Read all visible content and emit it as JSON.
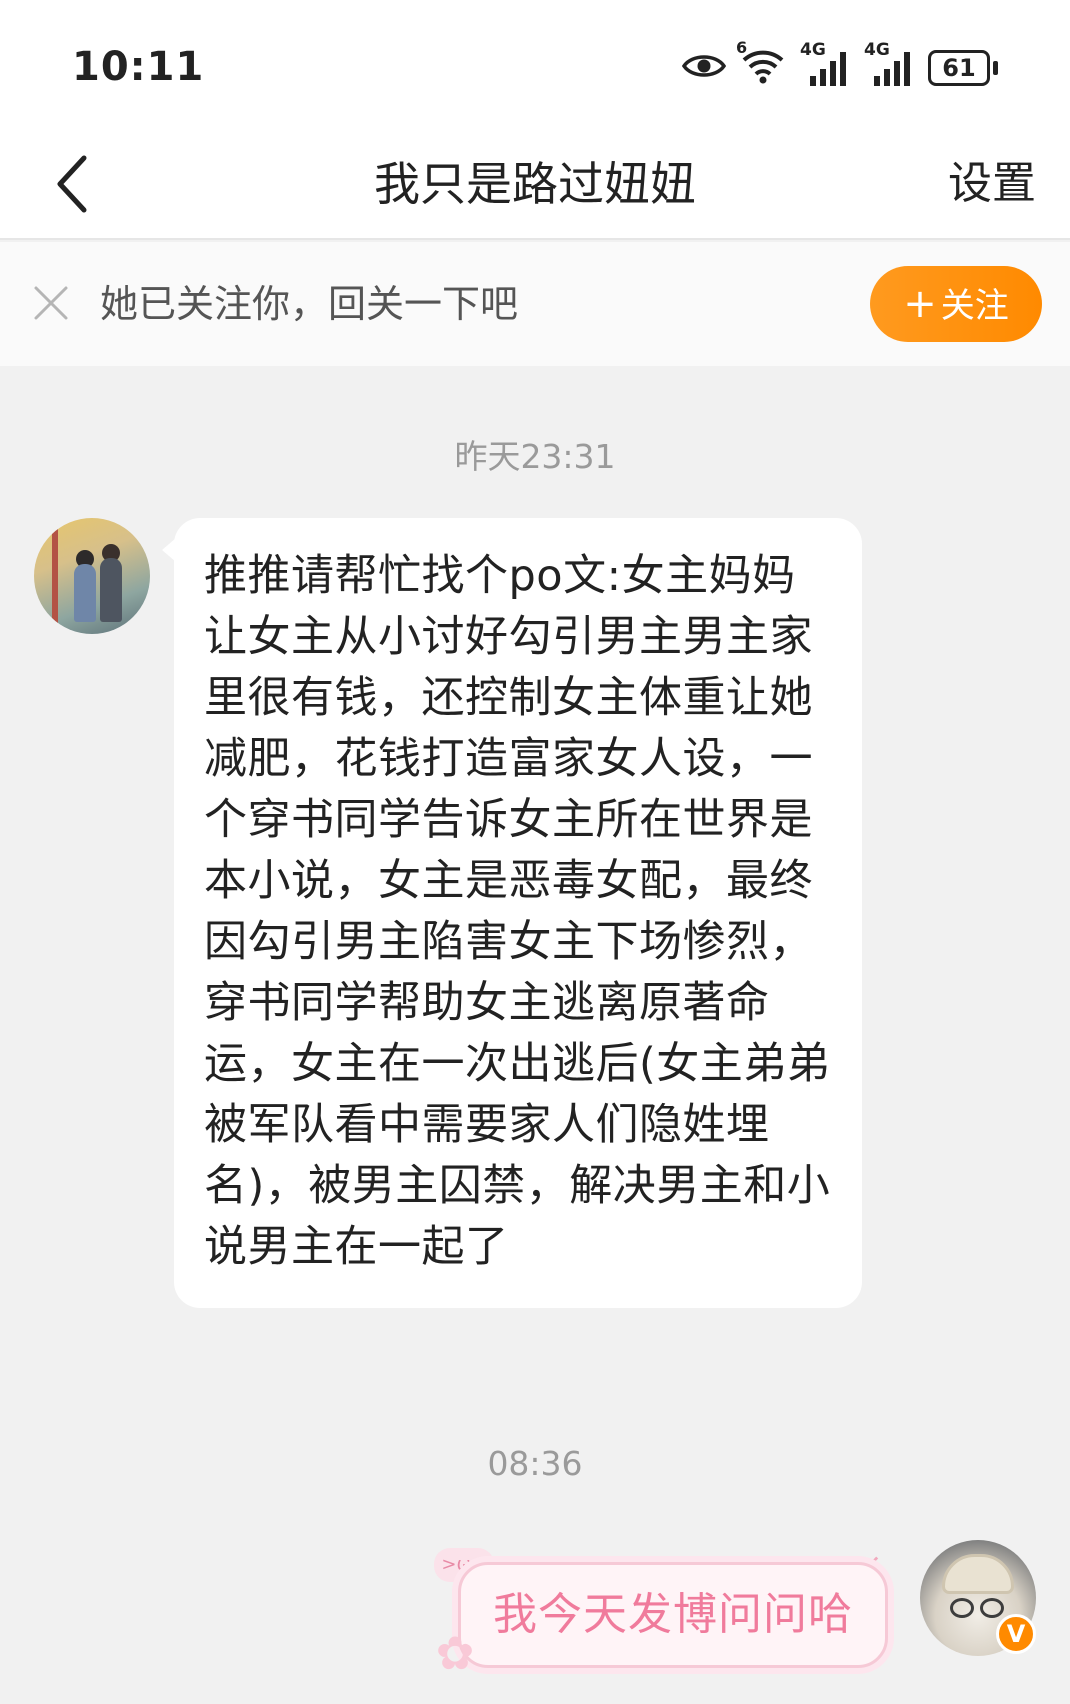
{
  "status_bar": {
    "time": "10:11",
    "wifi_superscript": "6",
    "signal1_label": "4G",
    "signal2_label": "4G",
    "battery": "61"
  },
  "nav": {
    "title": "我只是路过妞妞",
    "settings_label": "设置"
  },
  "follow_banner": {
    "text": "她已关注你，回关一下吧",
    "button_label": "关注",
    "button_color": "#ff9a1f"
  },
  "messages": [
    {
      "timestamp": "昨天23:31",
      "sender": "other",
      "text": "推推请帮忙找个po文:女主妈妈让女主从小讨好勾引男主男主家里很有钱，还控制女主体重让她减肥，花钱打造富家女人设，一个穿书同学告诉女主所在世界是本小说，女主是恶毒女配，最终因勾引男主陷害女主下场惨烈，穿书同学帮助女主逃离原著命运，女主在一次出逃后(女主弟弟被军队看中需要家人们隐姓埋名)，被男主囚禁，解决男主和小说男主在一起了"
    },
    {
      "timestamp": "08:36",
      "sender": "self",
      "text": "我今天发博问问哈",
      "decoration_text": ">ω<"
    }
  ],
  "colors": {
    "accent": "#ff8a00",
    "self_bubble_text": "#f07b9c",
    "background": "#f1f1f1"
  }
}
